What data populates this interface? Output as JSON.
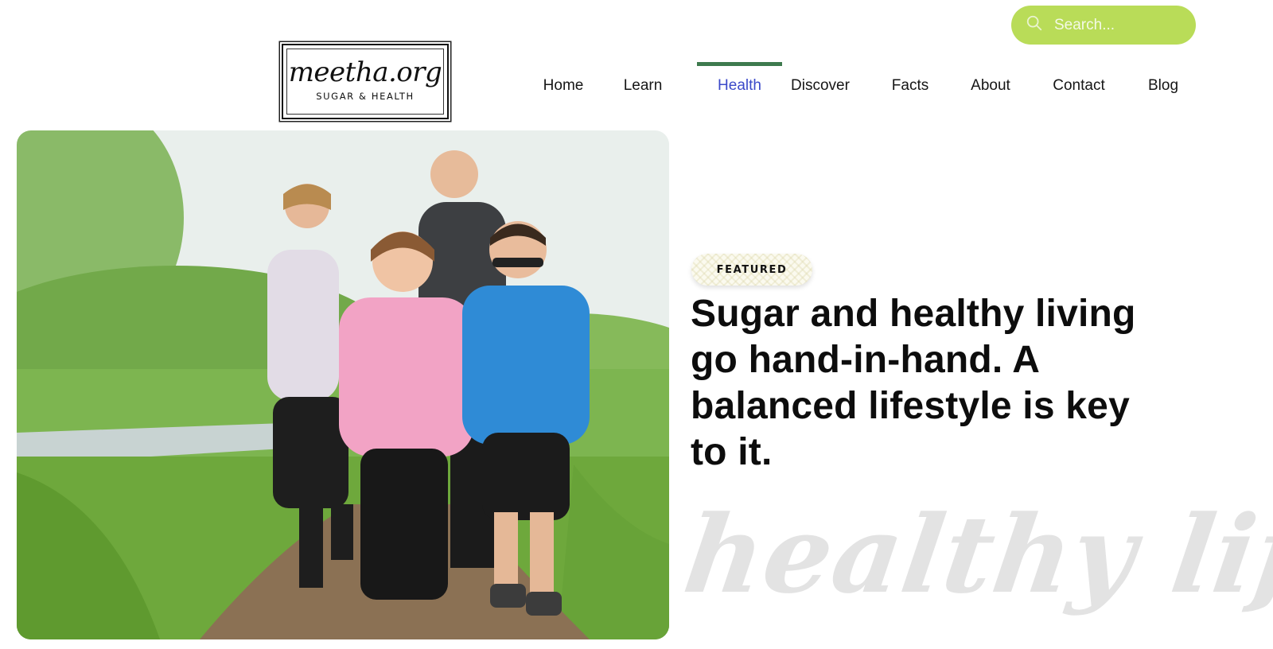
{
  "search": {
    "placeholder": "Search..."
  },
  "logo": {
    "name": "meetha.org",
    "tagline": "SUGAR & HEALTH"
  },
  "nav": {
    "items": [
      {
        "label": "Home",
        "active": false
      },
      {
        "label": "Learn",
        "active": false
      },
      {
        "label": "Health",
        "active": true
      },
      {
        "label": "Discover",
        "active": false
      },
      {
        "label": "Facts",
        "active": false
      },
      {
        "label": "About",
        "active": false
      },
      {
        "label": "Contact",
        "active": false
      },
      {
        "label": "Blog",
        "active": false
      }
    ]
  },
  "hero": {
    "badge": "FEATURED",
    "headline": "Sugar and healthy living go hand-in-hand. A balanced lifestyle is key to it.",
    "decor_text": "healthy life"
  },
  "colors": {
    "search_bg": "#b9dc58",
    "nav_active": "#3b49c9",
    "nav_indicator": "#3e7a4e",
    "decor_text": "#e3e3e3"
  }
}
